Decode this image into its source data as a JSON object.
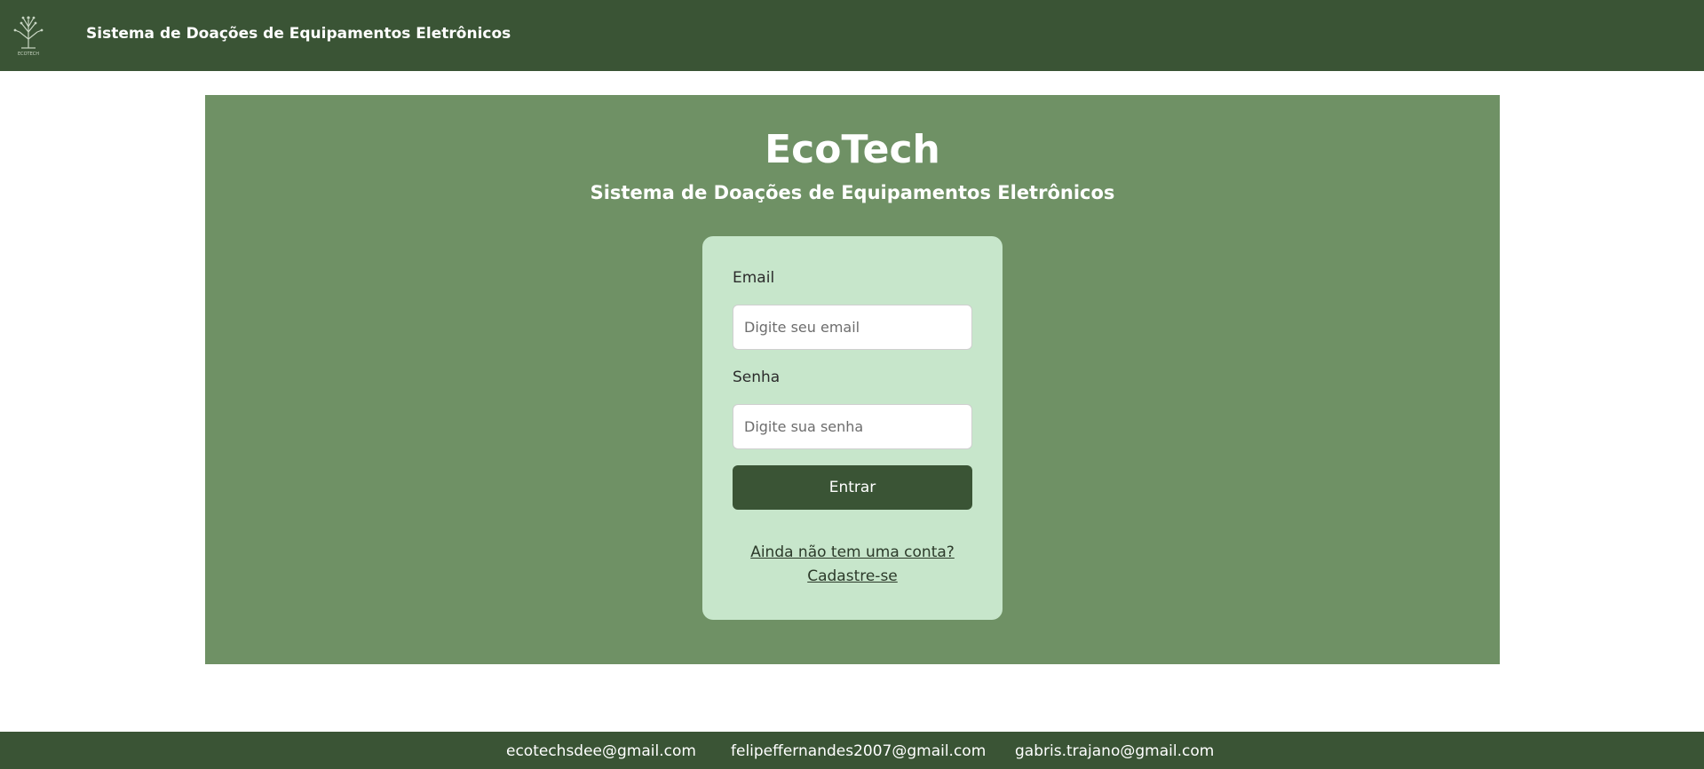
{
  "header": {
    "logo_text": "ECOTECH",
    "title": "Sistema de Doações de Equipamentos Eletrônicos"
  },
  "hero": {
    "title": "EcoTech",
    "subtitle": "Sistema de Doações de Equipamentos Eletrônicos"
  },
  "login": {
    "email_label": "Email",
    "email_placeholder": "Digite seu email",
    "password_label": "Senha",
    "password_placeholder": "Digite sua senha",
    "submit_label": "Entrar",
    "signup_line1": "Ainda não tem uma conta?",
    "signup_line2": "Cadastre-se"
  },
  "footer": {
    "emails": [
      "ecotechsdee@gmail.com",
      "felipeffernandes2007@gmail.com",
      "gabris.trajano@gmail.com"
    ]
  },
  "colors": {
    "header_bg": "#3a5435",
    "hero_bg": "#6f9165",
    "card_bg": "#c7e6cb",
    "button_bg": "#3a5435"
  }
}
